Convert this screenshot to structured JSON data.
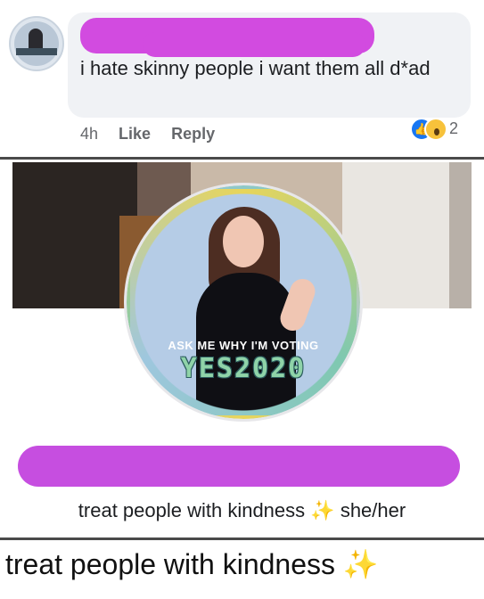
{
  "comment": {
    "text": "i hate skinny people i want them all d*ad",
    "time": "4h",
    "like_label": "Like",
    "reply_label": "Reply",
    "reaction_count": "2",
    "reaction_icons": [
      "like-icon",
      "wow-icon"
    ]
  },
  "profile_frame": {
    "ask_text": "ASK ME WHY I'M VOTING",
    "yes_text": "YES2020"
  },
  "bio": {
    "text": "treat people with kindness",
    "sparkle": "✨",
    "pronouns": "she/her"
  },
  "caption": {
    "text": "treat people with kindness",
    "sparkle": "✨"
  },
  "colors": {
    "redaction": "#d24be0",
    "like_blue": "#1877f2",
    "bubble_bg": "#f0f2f5"
  }
}
